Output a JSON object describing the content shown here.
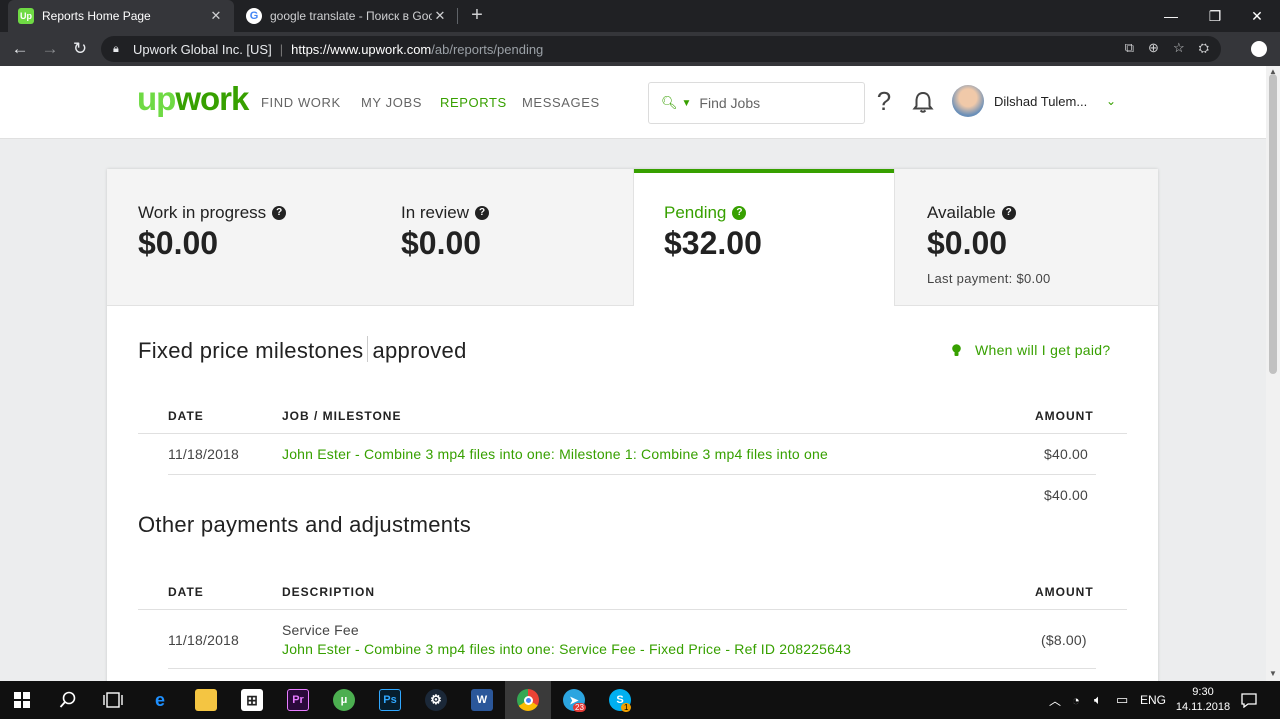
{
  "browser": {
    "tabs": [
      {
        "title": "Reports Home Page",
        "favicon": "upwork-favicon",
        "active": true
      },
      {
        "title": "google translate - Поиск в Goog",
        "favicon": "google-favicon",
        "active": false
      }
    ],
    "org": "Upwork Global Inc. [US]",
    "url_host": "https://www.upwork.com",
    "url_path": "/ab/reports/pending"
  },
  "header": {
    "logo_up": "up",
    "logo_work": "work",
    "nav": [
      "FIND WORK",
      "MY JOBS",
      "REPORTS",
      "MESSAGES"
    ],
    "active_nav": "REPORTS",
    "search_placeholder": "Find Jobs",
    "help": "?",
    "username": "Dilshad Tulem..."
  },
  "stats": [
    {
      "label": "Work in progress",
      "value": "$0.00"
    },
    {
      "label": "In review",
      "value": "$0.00"
    },
    {
      "label": "Pending",
      "value": "$32.00"
    },
    {
      "label": "Available",
      "value": "$0.00",
      "sub": "Last payment: $0.00"
    }
  ],
  "milestones": {
    "title": "Fixed price milestones",
    "title_status": "approved",
    "when_paid": "When will I get paid?",
    "headers": [
      "DATE",
      "JOB / MILESTONE",
      "AMOUNT"
    ],
    "rows": [
      {
        "date": "11/18/2018",
        "job": "John Ester - Combine 3 mp4 files into one: Milestone 1: Combine 3 mp4 files into one",
        "amount": "$40.00"
      }
    ],
    "total": "$40.00"
  },
  "other": {
    "title": "Other payments and adjustments",
    "headers": [
      "DATE",
      "DESCRIPTION",
      "AMOUNT"
    ],
    "rows": [
      {
        "date": "11/18/2018",
        "type": "Service Fee",
        "description": "John Ester - Combine 3 mp4 files into one: Service Fee - Fixed Price - Ref ID 208225643",
        "amount": "($8.00)"
      }
    ]
  },
  "taskbar": {
    "lang": "ENG",
    "time": "9:30",
    "date": "14.11.2018",
    "telegram_badge": "23",
    "skype_badge": "1"
  },
  "colors": {
    "brand_green": "#37a000",
    "logo_light_green": "#6fda44"
  }
}
